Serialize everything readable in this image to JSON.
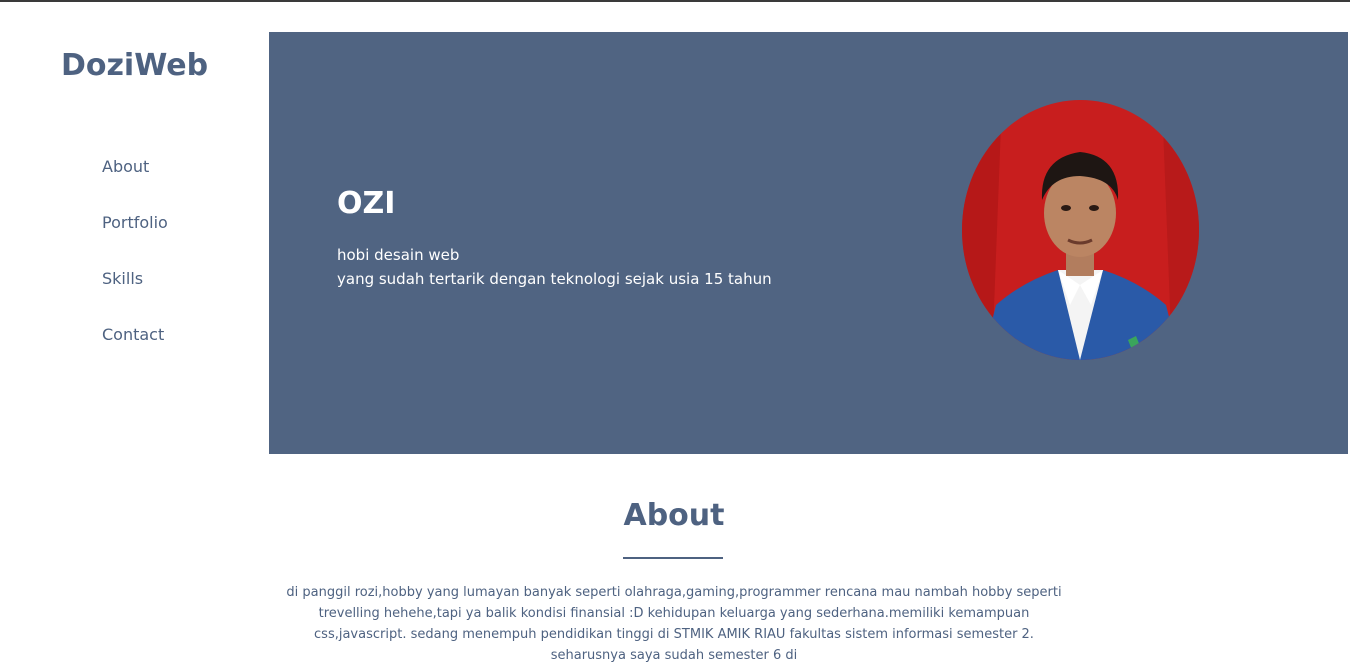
{
  "brand": {
    "name": "DoziWeb"
  },
  "nav": {
    "items": [
      {
        "label": "About"
      },
      {
        "label": "Portfolio"
      },
      {
        "label": "Skills"
      },
      {
        "label": "Contact"
      }
    ]
  },
  "hero": {
    "name": "OZI",
    "line1": "hobi desain web",
    "line2": "yang sudah tertarik dengan teknologi sejak usia 15 tahun",
    "photo_icon": "profile-photo"
  },
  "about": {
    "title": "About",
    "text": "di panggil rozi,hobby yang lumayan banyak seperti olahraga,gaming,programmer rencana mau nambah hobby seperti trevelling hehehe,tapi ya balik kondisi finansial :D kehidupan keluarga yang sederhana.memiliki kemampuan css,javascript. sedang menempuh pendidikan tinggi di STMIK AMIK RIAU fakultas sistem informasi semester 2. seharusnya saya sudah semester 6 di"
  },
  "colors": {
    "accent": "#4e6281",
    "hero_bg": "#506482",
    "photo_bg": "#c81e1e",
    "jacket": "#2a5aa8"
  }
}
